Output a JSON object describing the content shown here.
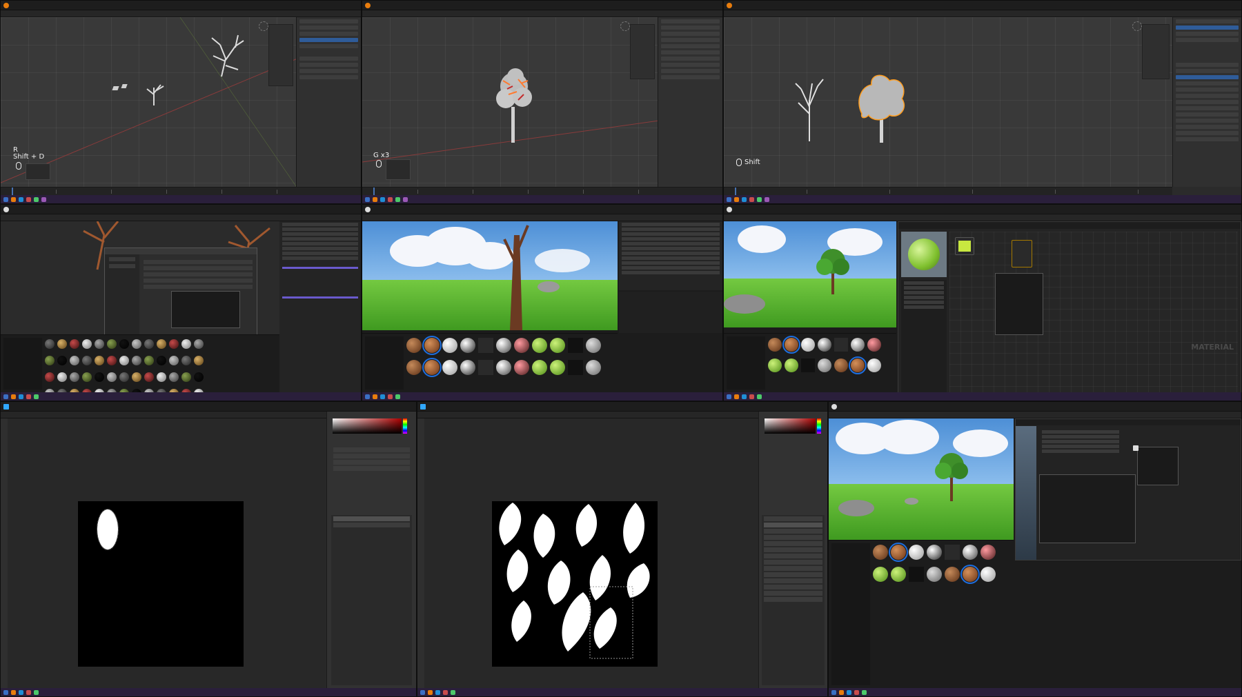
{
  "panels": {
    "p1": {
      "key_hint_r": "R",
      "key_hint_shift_d": "Shift + D"
    },
    "p2": {
      "key_hint": "G x3"
    },
    "p3": {
      "key_hint": "Shift"
    },
    "p6": {
      "watermark": "MATERIAL"
    }
  },
  "colors": {
    "blender_bg": "#393939",
    "selection_orange": "#ff9d1f",
    "selection_blue": "#1e6fe0",
    "taskbar": "#2a1f3b",
    "grass": "#5bb52f",
    "sky": "#6aa8e4"
  },
  "icons": [
    "blender-icon",
    "unreal-icon",
    "photoshop-icon",
    "taskbar-app-icon",
    "mouse-icon",
    "shield-icon"
  ]
}
